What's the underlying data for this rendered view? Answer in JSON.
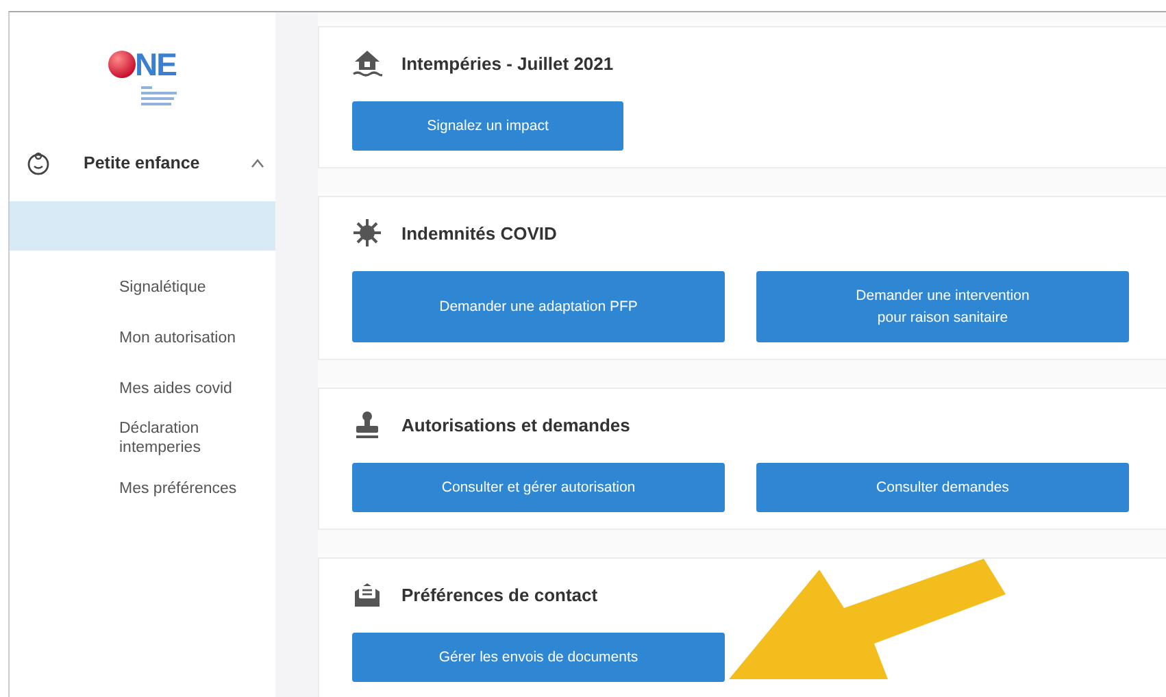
{
  "logo": {
    "text": "NE"
  },
  "sidebar": {
    "section": {
      "label": "Petite enfance",
      "expanded": true
    },
    "items": [
      {
        "selected": true
      },
      {
        "label": "Signalétique",
        "selected": false
      },
      {
        "label": "Mon autorisation",
        "selected": false
      },
      {
        "label": "Mes aides covid",
        "selected": false
      },
      {
        "label": "Déclaration intemperies",
        "selected": false
      },
      {
        "label": "Mes préférences",
        "selected": false
      }
    ]
  },
  "sections": [
    {
      "kind": "weather",
      "title": "Intempéries - Juillet 2021",
      "buttons": [
        "Signalez un impact"
      ]
    },
    {
      "kind": "virus",
      "title": "Indemnités COVID",
      "buttons": [
        "Demander une adaptation PFP",
        "Demander une intervention\npour raison sanitaire"
      ]
    },
    {
      "kind": "stamp",
      "title": "Autorisations et demandes",
      "buttons": [
        "Consulter et gérer autorisation",
        "Consulter demandes"
      ]
    },
    {
      "kind": "mail",
      "title": "Préférences de contact",
      "buttons": [
        "Gérer les envois de documents"
      ]
    }
  ]
}
